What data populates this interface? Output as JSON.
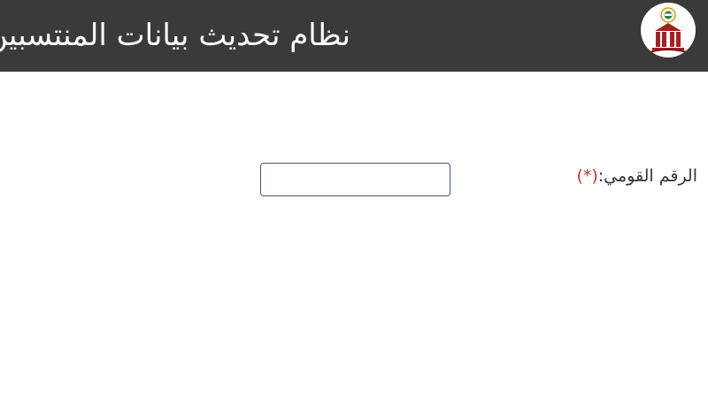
{
  "header": {
    "title": "نظام تحديث بيانات المنتسبين",
    "logo_icon": "university-building-logo",
    "background_color": "#3a3a3a"
  },
  "form": {
    "national_id": {
      "label": "الرقم القومي:",
      "required_mark": "(*)",
      "value": "",
      "placeholder": ""
    }
  },
  "colors": {
    "required": "#c0392b",
    "logo_red": "#a81f23"
  }
}
